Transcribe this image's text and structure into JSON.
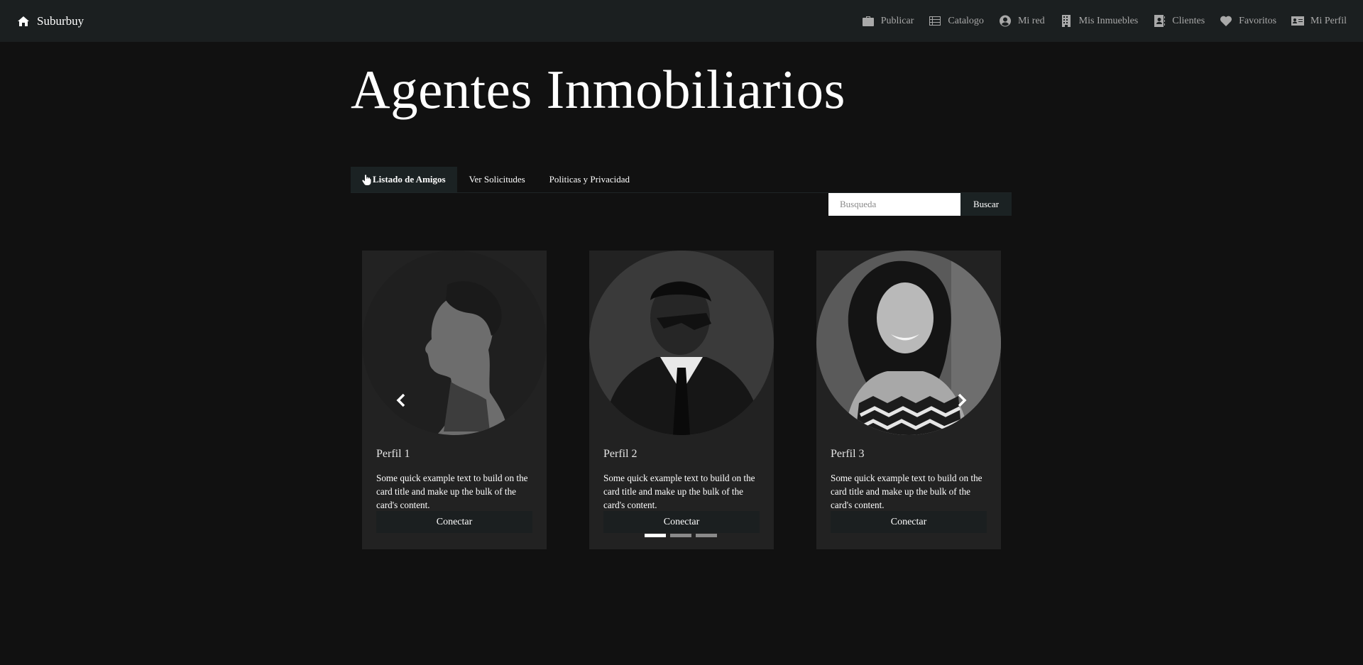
{
  "nav": {
    "brand": "Suburbuy",
    "items": [
      {
        "label": "Publicar",
        "icon": "briefcase-icon"
      },
      {
        "label": "Catalogo",
        "icon": "list-icon"
      },
      {
        "label": "Mi red",
        "icon": "user-circle-icon"
      },
      {
        "label": "Mis Inmuebles",
        "icon": "building-icon"
      },
      {
        "label": "Clientes",
        "icon": "address-book-icon"
      },
      {
        "label": "Favoritos",
        "icon": "heart-icon"
      },
      {
        "label": "Mi Perfil",
        "icon": "id-card-icon"
      }
    ]
  },
  "page": {
    "title": "Agentes Inmobiliarios"
  },
  "tabs": [
    {
      "label": "Listado de Amigos",
      "active": true,
      "icon": "hand-pointer-icon"
    },
    {
      "label": "Ver Solicitudes",
      "active": false
    },
    {
      "label": "Politicas y Privacidad",
      "active": false
    }
  ],
  "search": {
    "placeholder": "Busqueda",
    "value": "",
    "button_label": "Buscar"
  },
  "cards": [
    {
      "title": "Perfil 1",
      "text": "Some quick example text to build on the card title and make up the bulk of the card's content.",
      "button_label": "Conectar"
    },
    {
      "title": "Perfil 2",
      "text": "Some quick example text to build on the card title and make up the bulk of the card's content.",
      "button_label": "Conectar"
    },
    {
      "title": "Perfil 3",
      "text": "Some quick example text to build on the card title and make up the bulk of the card's content.",
      "button_label": "Conectar"
    }
  ],
  "carousel": {
    "active_index": 0,
    "slide_count": 3
  },
  "colors": {
    "background": "#111111",
    "navbar": "#1b1f20",
    "card": "#222222",
    "accent": "#ffffff"
  }
}
